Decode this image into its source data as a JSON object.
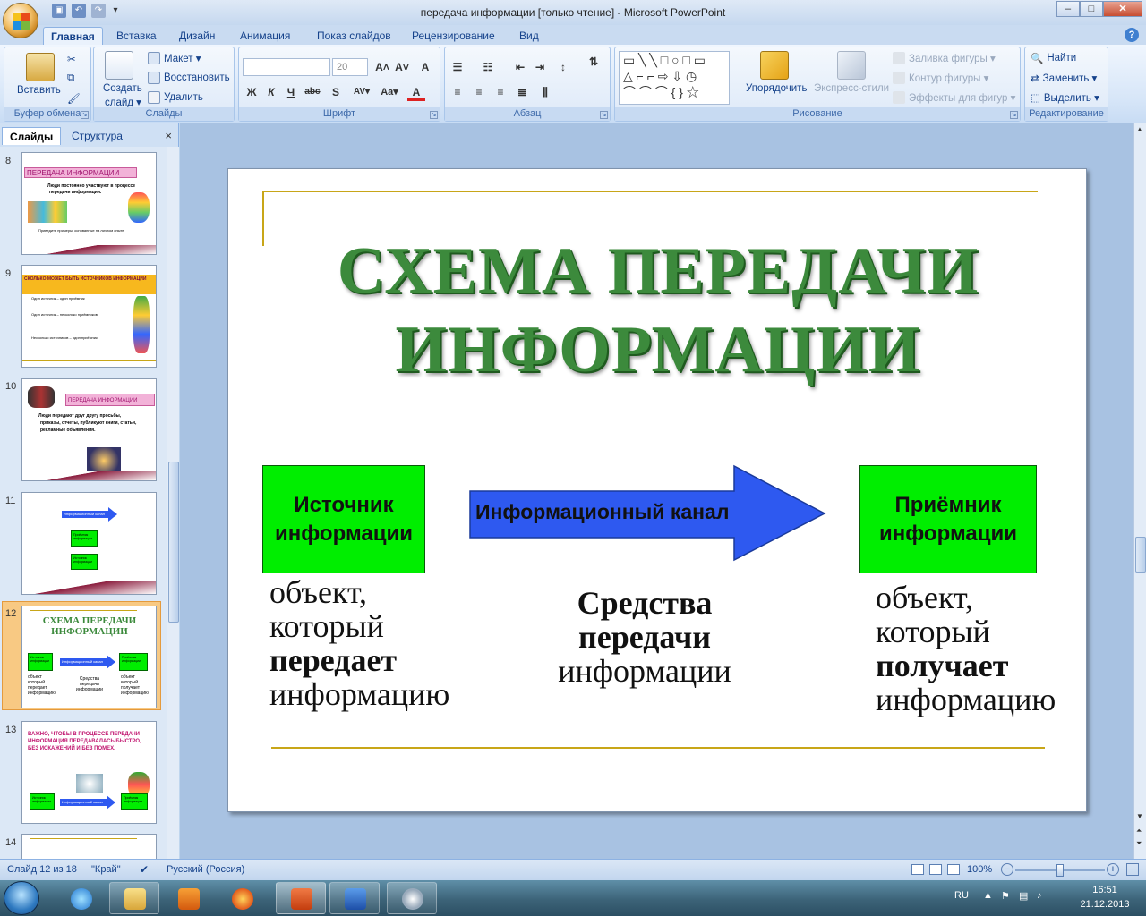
{
  "window": {
    "title": "передача информации  [только чтение] - Microsoft PowerPoint",
    "minimize": "–",
    "maximize": "□",
    "close": "✕"
  },
  "ribbon_tabs": [
    "Главная",
    "Вставка",
    "Дизайн",
    "Анимация",
    "Показ слайдов",
    "Рецензирование",
    "Вид"
  ],
  "ribbon": {
    "clipboard": {
      "label": "Буфер обмена",
      "paste": "Вставить"
    },
    "slides": {
      "label": "Слайды",
      "new_slide_1": "Создать",
      "new_slide_2": "слайд ▾",
      "layout": "Макет ▾",
      "reset": "Восстановить",
      "delete": "Удалить"
    },
    "font": {
      "label": "Шрифт",
      "font_size": "20",
      "bold": "Ж",
      "italic": "К",
      "underline": "Ч",
      "strike": "abc",
      "shadow": "S",
      "spacing": "AV▾",
      "case": "Aa▾",
      "color": "A",
      "grow": "A˄",
      "shrink": "A˅",
      "clear": "A"
    },
    "paragraph": {
      "label": "Абзац"
    },
    "drawing": {
      "label": "Рисование",
      "arrange": "Упорядочить",
      "quick_styles": "Экспресс-стили",
      "fill": "Заливка фигуры ▾",
      "outline": "Контур фигуры ▾",
      "effects": "Эффекты для фигур ▾"
    },
    "editing": {
      "label": "Редактирование",
      "find": "Найти",
      "replace": "Заменить ▾",
      "select": "Выделить ▾"
    }
  },
  "left_pane": {
    "tab_slides": "Слайды",
    "tab_outline": "Структура",
    "close": "×",
    "thumbnails": [
      {
        "num": "8",
        "title": "ПЕРЕДАЧА ИНФОРМАЦИИ",
        "line1": "Люди постоянно участвуют в процессе",
        "line2": "передачи информации.",
        "line3": "Приведите примеры, основанные на личном опыте"
      },
      {
        "num": "9",
        "title": "СКОЛЬКО МОЖЕТ БЫТЬ ИСТОЧНИКОВ ИНФОРМАЦИИ",
        "line1": "Один источник – один приёмник",
        "line2": "Один источник – несколько приёмников",
        "line3": "Несколько источников – один приёмник"
      },
      {
        "num": "10",
        "title": "ПЕРЕДАЧА ИНФОРМАЦИИ",
        "line1": "Люди передают друг другу просьбы,",
        "line2": "приказы, отчеты, публикуют книги, статьи,",
        "line3": "рекламные объявления."
      },
      {
        "num": "11",
        "title": "",
        "arrow": "Информационный канал",
        "box1": "Приёмник информации",
        "box2": "Источник информации"
      },
      {
        "num": "12",
        "title": "СХЕМА ПЕРЕДАЧИ ИНФОРМАЦИИ",
        "box1": "Источник информации",
        "arrow": "Информационный канал",
        "box2": "Приёмник информации",
        "c1": "объект который передает информацию",
        "c2": "Средства передачи информации",
        "c3": "объект который получает информацию"
      },
      {
        "num": "13",
        "title": "ВАЖНО, ЧТОБЫ В ПРОЦЕССЕ ПЕРЕДАЧИ ИНФОРМАЦИЯ ПЕРЕДАВАЛАСЬ БЫСТРО, БЕЗ ИСКАЖЕНИЙ И БЕЗ ПОМЕХ.",
        "box1": "Источник информации",
        "arrow": "Информационный канал",
        "box2": "Приёмник информации"
      },
      {
        "num": "14"
      }
    ]
  },
  "slide": {
    "title_line1": "СХЕМА ПЕРЕДАЧИ",
    "title_line2": "ИНФОРМАЦИИ",
    "source_box": "Источник информации",
    "channel_arrow": "Информационный канал",
    "receiver_box": "Приёмник информации",
    "source_desc": {
      "l1": "объект,",
      "l2": "который",
      "l3": "передает",
      "l4": "информацию"
    },
    "channel_desc": {
      "l1": "Средства",
      "l2": "передачи",
      "l3": "информации"
    },
    "receiver_desc": {
      "l1": "объект,",
      "l2": "который",
      "l3": "получает",
      "l4": "информацию"
    }
  },
  "statusbar": {
    "slide_info": "Слайд 12 из 18",
    "theme": "\"Край\"",
    "language": "Русский (Россия)",
    "zoom": "100%",
    "zoom_level": 0.5
  },
  "taskbar": {
    "lang": "RU",
    "time": "16:51",
    "date": "21.12.2013"
  },
  "colors": {
    "box_green": "#00ee00",
    "arrow_blue": "#2e59f0",
    "title_green": "#3c8a3c",
    "rule_gold": "#c8a618"
  }
}
